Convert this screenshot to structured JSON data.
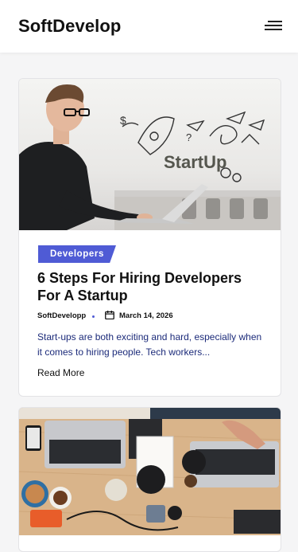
{
  "header": {
    "logo": "SoftDevelop",
    "menu_icon": "hamburger-menu-icon"
  },
  "posts": [
    {
      "image": "man-with-laptop-startup-sketch",
      "category": "Developers",
      "title": "6 Steps For Hiring Developers For A Startup",
      "author": "SoftDevelopp",
      "date": "March 14, 2026",
      "excerpt": "Start-ups are both exciting and hard, especially when it comes to hiring people. Tech workers...",
      "read_more": "Read More",
      "image_text": "StartUp"
    },
    {
      "image": "team-desk-with-laptops-top-view"
    }
  ],
  "colors": {
    "accent": "#4f5bd5",
    "excerpt": "#1c2b7a",
    "background": "#f5f5f6"
  }
}
